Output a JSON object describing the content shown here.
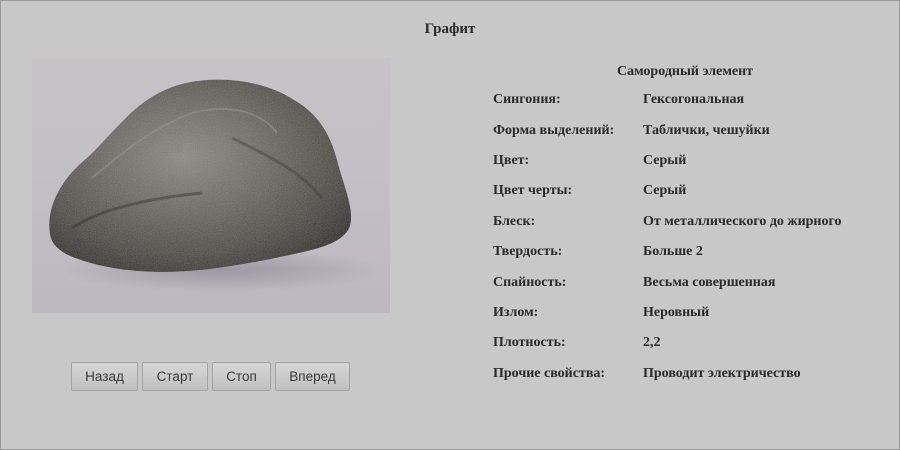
{
  "page": {
    "title": "Графит"
  },
  "photo": {
    "subject": "mineral-specimen"
  },
  "controls": {
    "back": "Назад",
    "start": "Старт",
    "stop": "Стоп",
    "next": "Вперед"
  },
  "properties": {
    "header": "Самородный элемент",
    "rows": [
      {
        "label": "Сингония:",
        "value": "Гексогональная"
      },
      {
        "label": "Форма выделений:",
        "value": "Таблички, чешуйки"
      },
      {
        "label": "Цвет:",
        "value": "Серый"
      },
      {
        "label": "Цвет черты:",
        "value": "Серый"
      },
      {
        "label": "Блеск:",
        "value": "От металлического до жирного"
      },
      {
        "label": "Твердость:",
        "value": "Больше 2"
      },
      {
        "label": "Спайность:",
        "value": "Весьма совершенная"
      },
      {
        "label": "Излом:",
        "value": "Неровный"
      },
      {
        "label": "Плотность:",
        "value": "2,2"
      },
      {
        "label": "Прочие свойства:",
        "value": "Проводит электричество"
      }
    ]
  }
}
